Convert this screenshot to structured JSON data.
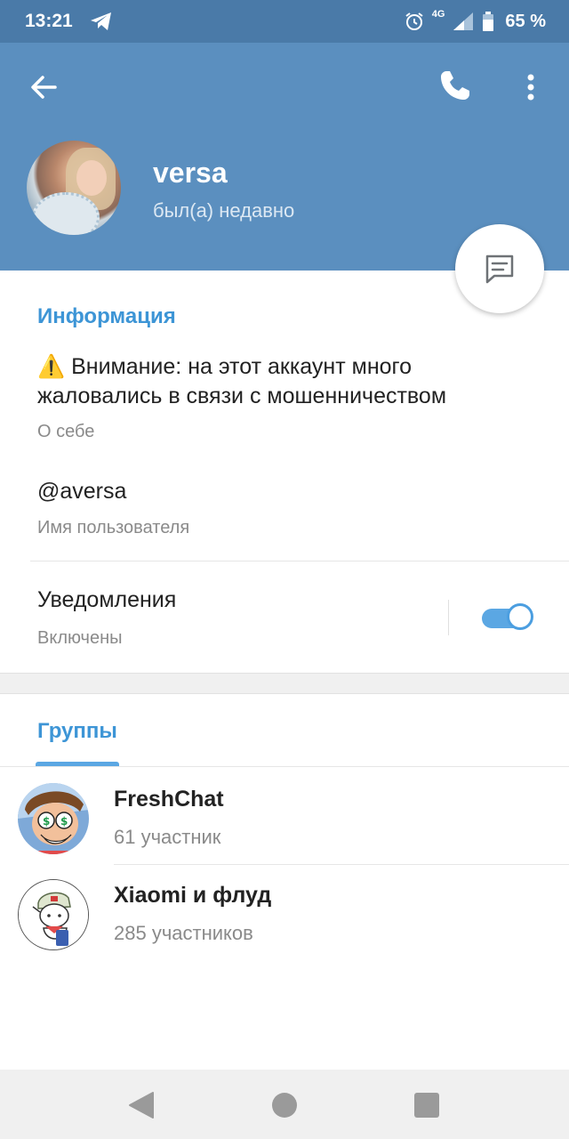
{
  "status_bar": {
    "time": "13:21",
    "network": "4G",
    "battery": "65 %"
  },
  "header": {
    "name": "versa",
    "status": "был(а) недавно",
    "color": "#5b8fbf"
  },
  "info": {
    "section_title": "Информация",
    "bio_emoji": "⚠️",
    "bio": "Внимание: на этот аккаунт много жаловались в связи с мошенничеством",
    "bio_label": "О себе",
    "username": "@aversa",
    "username_label": "Имя пользователя",
    "notifications": "Уведомления",
    "notifications_state": "Включены",
    "notifications_on": true
  },
  "groups": {
    "tab_label": "Группы",
    "items": [
      {
        "name": "FreshChat",
        "members": "61 участник"
      },
      {
        "name": "Xiaomi и флуд",
        "members": "285 участников"
      }
    ]
  },
  "icons": {
    "back": "arrow-left-icon",
    "call": "phone-icon",
    "menu": "more-vertical-icon",
    "message": "message-icon",
    "alarm": "alarm-icon",
    "telegram": "telegram-icon"
  },
  "colors": {
    "accent": "#3d95d6",
    "status_bar": "#4a7aa8"
  }
}
